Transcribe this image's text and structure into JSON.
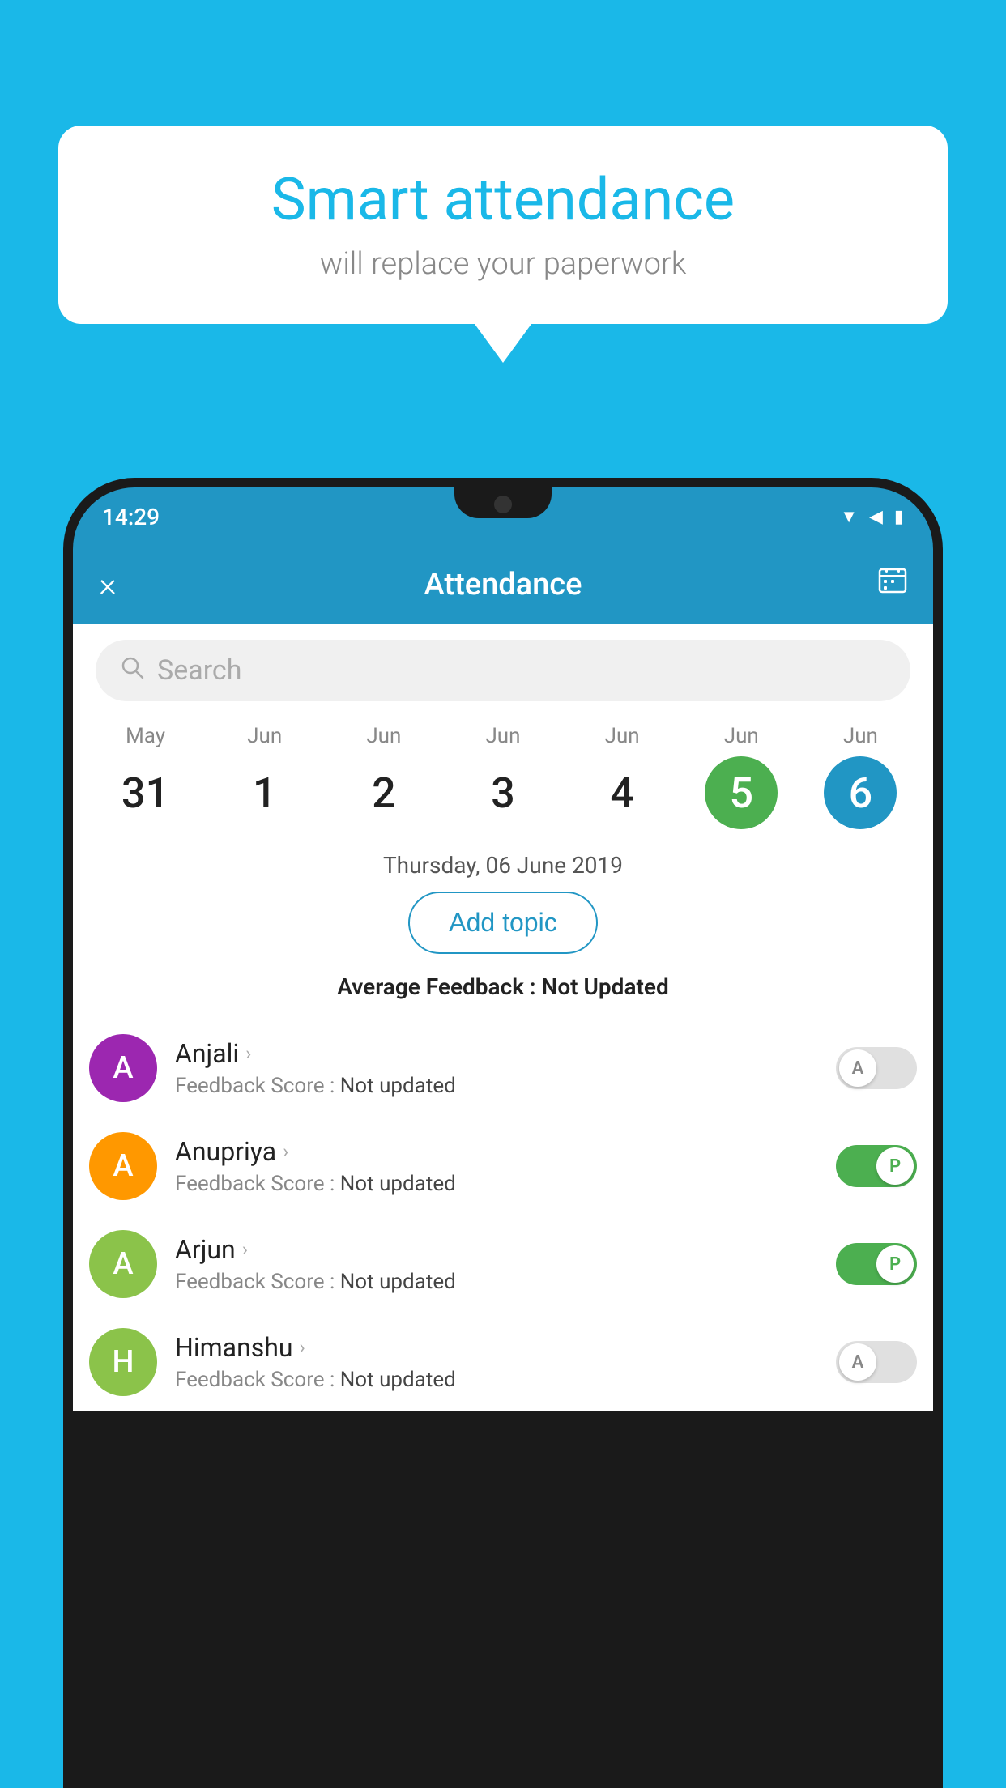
{
  "background_color": "#1ab8e8",
  "bubble": {
    "title": "Smart attendance",
    "subtitle": "will replace your paperwork"
  },
  "status_bar": {
    "time": "14:29",
    "icons": [
      "wifi",
      "signal",
      "battery"
    ]
  },
  "app_bar": {
    "title": "Attendance",
    "close_label": "×",
    "calendar_icon": "📅"
  },
  "search": {
    "placeholder": "Search"
  },
  "calendar": {
    "days": [
      {
        "month": "May",
        "date": "31",
        "state": "normal"
      },
      {
        "month": "Jun",
        "date": "1",
        "state": "normal"
      },
      {
        "month": "Jun",
        "date": "2",
        "state": "normal"
      },
      {
        "month": "Jun",
        "date": "3",
        "state": "normal"
      },
      {
        "month": "Jun",
        "date": "4",
        "state": "normal"
      },
      {
        "month": "Jun",
        "date": "5",
        "state": "today"
      },
      {
        "month": "Jun",
        "date": "6",
        "state": "selected"
      }
    ]
  },
  "selected_date": "Thursday, 06 June 2019",
  "add_topic_label": "Add topic",
  "avg_feedback_label": "Average Feedback :",
  "avg_feedback_value": "Not Updated",
  "students": [
    {
      "name": "Anjali",
      "avatar_letter": "A",
      "avatar_color": "#9c27b0",
      "feedback_label": "Feedback Score :",
      "feedback_value": "Not updated",
      "toggle_state": "off",
      "toggle_label": "A"
    },
    {
      "name": "Anupriya",
      "avatar_letter": "A",
      "avatar_color": "#ff9800",
      "feedback_label": "Feedback Score :",
      "feedback_value": "Not updated",
      "toggle_state": "on",
      "toggle_label": "P"
    },
    {
      "name": "Arjun",
      "avatar_letter": "A",
      "avatar_color": "#8bc34a",
      "feedback_label": "Feedback Score :",
      "feedback_value": "Not updated",
      "toggle_state": "on",
      "toggle_label": "P"
    },
    {
      "name": "Himanshu",
      "avatar_letter": "H",
      "avatar_color": "#8bc34a",
      "feedback_label": "Feedback Score :",
      "feedback_value": "Not updated",
      "toggle_state": "off",
      "toggle_label": "A"
    }
  ]
}
